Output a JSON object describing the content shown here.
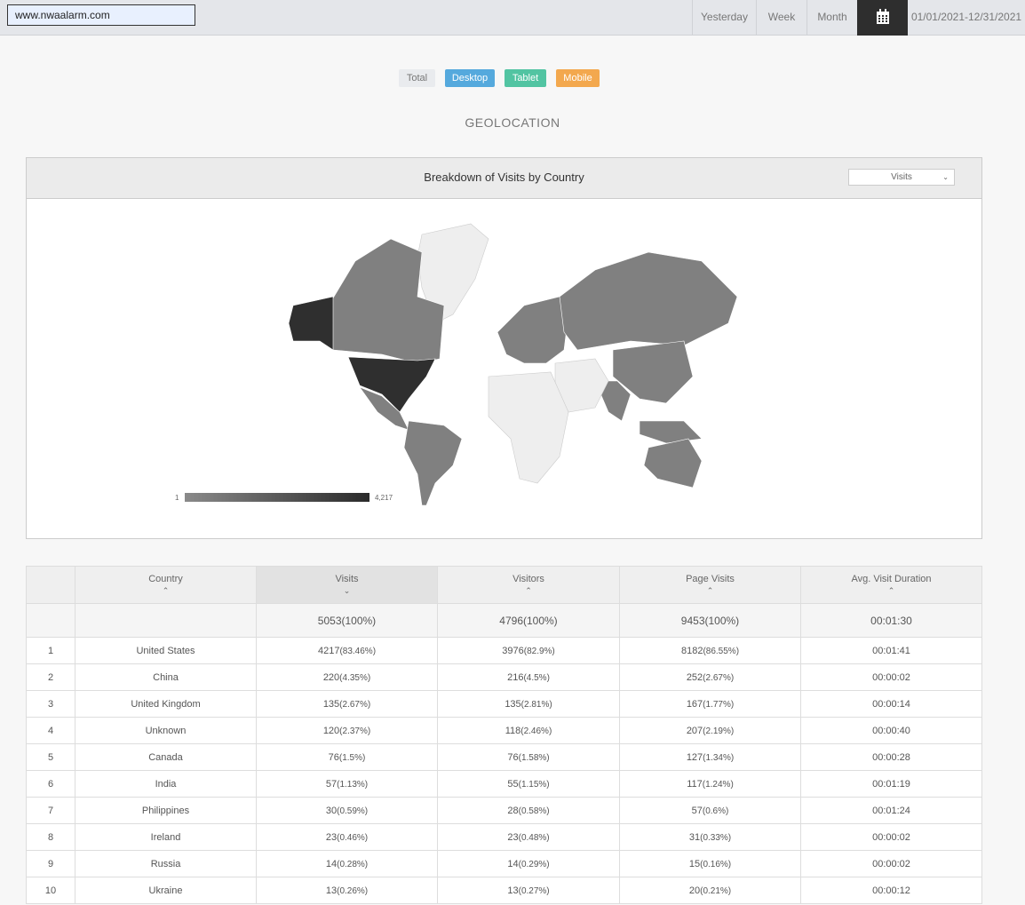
{
  "topbar": {
    "site": "www.nwaalarm.com",
    "ranges": [
      "Yesterday",
      "Week",
      "Month"
    ],
    "date_range": "01/01/2021-12/31/2021"
  },
  "filters": [
    {
      "label": "Total",
      "color": "#e9ebee"
    },
    {
      "label": "Desktop",
      "color": "#55a9dd"
    },
    {
      "label": "Tablet",
      "color": "#52c4a2"
    },
    {
      "label": "Mobile",
      "color": "#f3a84e"
    }
  ],
  "section_title": "GEOLOCATION",
  "map_panel": {
    "title": "Breakdown of Visits by Country",
    "metric_select": "Visits",
    "legend_min": "1",
    "legend_max": "4,217"
  },
  "table": {
    "headers": [
      "Country",
      "Visits",
      "Visitors",
      "Page Visits",
      "Avg. Visit Duration"
    ],
    "totals": {
      "visits": "5053(100%)",
      "visitors": "4796(100%)",
      "page_visits": "9453(100%)",
      "duration": "00:01:30"
    },
    "rows": [
      {
        "n": "1",
        "country": "United States",
        "visits": "4217",
        "visits_pct": "(83.46%)",
        "visitors": "3976",
        "visitors_pct": "(82.9%)",
        "pv": "8182",
        "pv_pct": "(86.55%)",
        "dur": "00:01:41"
      },
      {
        "n": "2",
        "country": "China",
        "visits": "220",
        "visits_pct": "(4.35%)",
        "visitors": "216",
        "visitors_pct": "(4.5%)",
        "pv": "252",
        "pv_pct": "(2.67%)",
        "dur": "00:00:02"
      },
      {
        "n": "3",
        "country": "United Kingdom",
        "visits": "135",
        "visits_pct": "(2.67%)",
        "visitors": "135",
        "visitors_pct": "(2.81%)",
        "pv": "167",
        "pv_pct": "(1.77%)",
        "dur": "00:00:14"
      },
      {
        "n": "4",
        "country": "Unknown",
        "visits": "120",
        "visits_pct": "(2.37%)",
        "visitors": "118",
        "visitors_pct": "(2.46%)",
        "pv": "207",
        "pv_pct": "(2.19%)",
        "dur": "00:00:40"
      },
      {
        "n": "5",
        "country": "Canada",
        "visits": "76",
        "visits_pct": "(1.5%)",
        "visitors": "76",
        "visitors_pct": "(1.58%)",
        "pv": "127",
        "pv_pct": "(1.34%)",
        "dur": "00:00:28"
      },
      {
        "n": "6",
        "country": "India",
        "visits": "57",
        "visits_pct": "(1.13%)",
        "visitors": "55",
        "visitors_pct": "(1.15%)",
        "pv": "117",
        "pv_pct": "(1.24%)",
        "dur": "00:01:19"
      },
      {
        "n": "7",
        "country": "Philippines",
        "visits": "30",
        "visits_pct": "(0.59%)",
        "visitors": "28",
        "visitors_pct": "(0.58%)",
        "pv": "57",
        "pv_pct": "(0.6%)",
        "dur": "00:01:24"
      },
      {
        "n": "8",
        "country": "Ireland",
        "visits": "23",
        "visits_pct": "(0.46%)",
        "visitors": "23",
        "visitors_pct": "(0.48%)",
        "pv": "31",
        "pv_pct": "(0.33%)",
        "dur": "00:00:02"
      },
      {
        "n": "9",
        "country": "Russia",
        "visits": "14",
        "visits_pct": "(0.28%)",
        "visitors": "14",
        "visitors_pct": "(0.29%)",
        "pv": "15",
        "pv_pct": "(0.16%)",
        "dur": "00:00:02"
      },
      {
        "n": "10",
        "country": "Ukraine",
        "visits": "13",
        "visits_pct": "(0.26%)",
        "visitors": "13",
        "visitors_pct": "(0.27%)",
        "pv": "20",
        "pv_pct": "(0.21%)",
        "dur": "00:00:12"
      }
    ]
  }
}
